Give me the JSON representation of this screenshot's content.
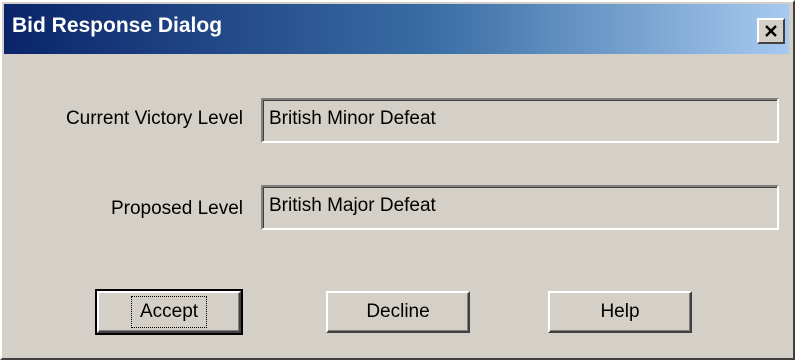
{
  "window": {
    "title": "Bid Response Dialog",
    "close_icon": "close-icon"
  },
  "fields": {
    "current_label": "Current Victory Level",
    "current_value": "British Minor Defeat",
    "proposed_label": "Proposed Level",
    "proposed_value": "British Major Defeat"
  },
  "buttons": {
    "accept": "Accept",
    "decline": "Decline",
    "help": "Help"
  },
  "colors": {
    "title_bar_start": "#0a246a",
    "title_bar_end": "#a6caf0",
    "face": "#d4d0c8"
  }
}
